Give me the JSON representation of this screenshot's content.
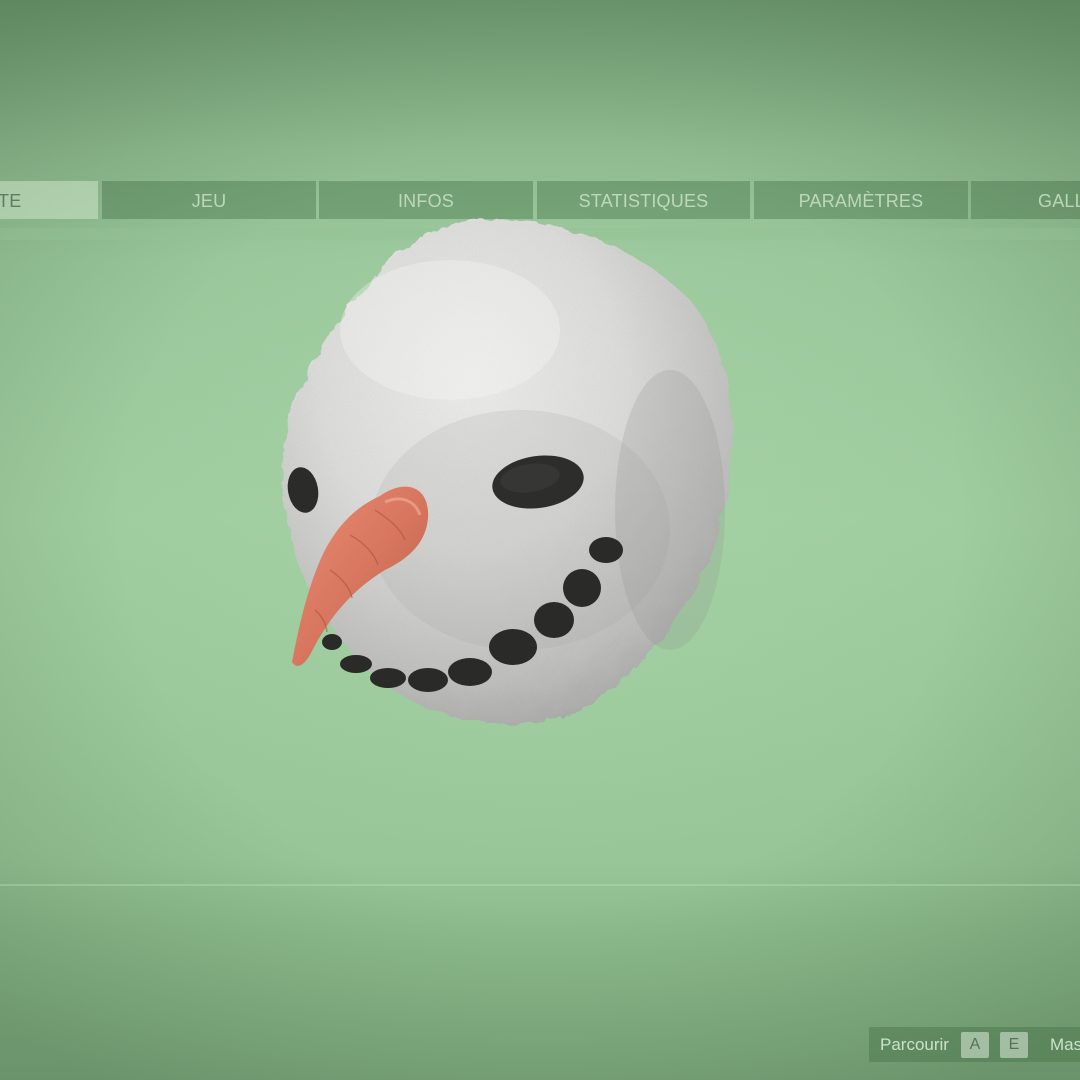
{
  "tabs": [
    {
      "label": "TE",
      "active": true
    },
    {
      "label": "JEU",
      "active": false
    },
    {
      "label": "INFOS",
      "active": false
    },
    {
      "label": "STATISTIQUES",
      "active": false
    },
    {
      "label": "PARAMÈTRES",
      "active": false
    },
    {
      "label": "GALL",
      "active": false
    }
  ],
  "preview": {
    "item_icon": "snowman-head-mask"
  },
  "hints": {
    "browse_label": "Parcourir",
    "key_left": "A",
    "key_right": "E",
    "hide_label": "Mas"
  },
  "colors": {
    "active_tab_indicator": "#5f95a6",
    "background": "#a0cda0"
  }
}
